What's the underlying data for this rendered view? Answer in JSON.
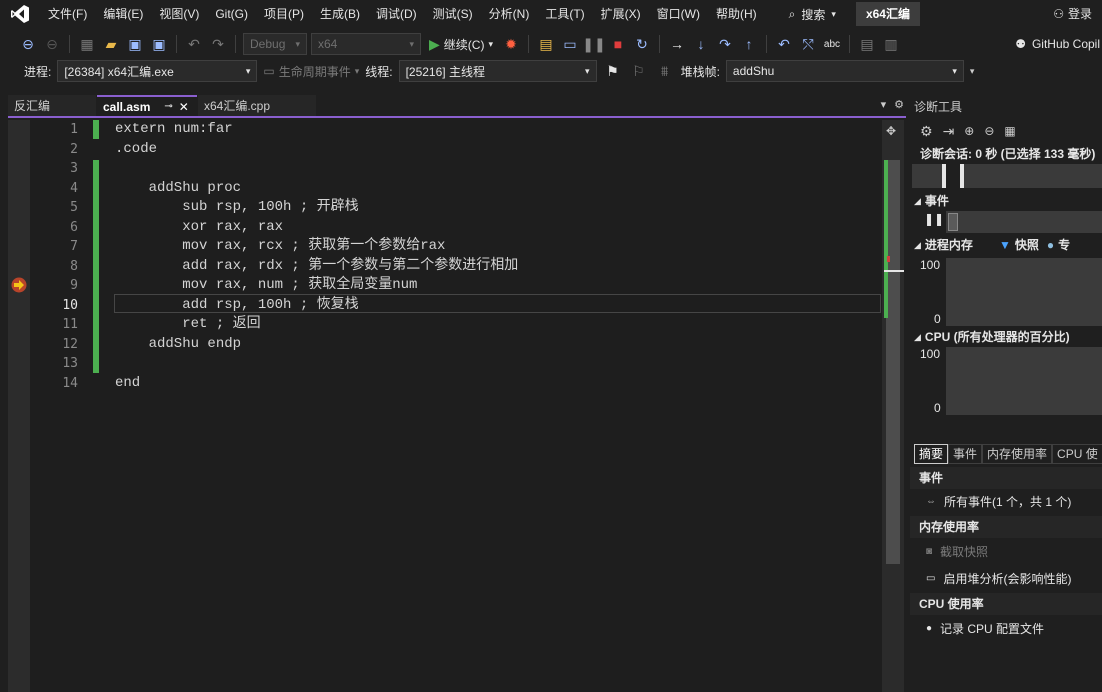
{
  "menubar": {
    "items": [
      "文件(F)",
      "编辑(E)",
      "视图(V)",
      "Git(G)",
      "项目(P)",
      "生成(B)",
      "调试(D)",
      "测试(S)",
      "分析(N)",
      "工具(T)",
      "扩展(X)",
      "窗口(W)",
      "帮助(H)"
    ],
    "search_label": "搜索",
    "solution_title": "x64汇编",
    "login_label": "登录"
  },
  "toolbar1": {
    "config": "Debug",
    "platform": "x64",
    "continue_label": "继续(C)",
    "copilot_label": "GitHub Copil"
  },
  "toolbar2": {
    "process_label": "进程:",
    "process_value": "[26384] x64汇编.exe",
    "lifecycle_label": "生命周期事件",
    "thread_label": "线程:",
    "thread_value": "[25216] 主线程",
    "stack_label": "堆栈帧:",
    "stack_value": "addShu"
  },
  "tabs": [
    {
      "label": "反汇编",
      "active": false
    },
    {
      "label": "call.asm",
      "active": true
    },
    {
      "label": "x64汇编.cpp",
      "active": false
    }
  ],
  "editor": {
    "current_line": 10,
    "breakpoint_line": 9,
    "lines": [
      {
        "num": "1",
        "text": "extern num:far"
      },
      {
        "num": "2",
        "text": ".code"
      },
      {
        "num": "3",
        "text": ""
      },
      {
        "num": "4",
        "text": "    addShu proc"
      },
      {
        "num": "5",
        "text": "        sub rsp, 100h ; 开辟栈"
      },
      {
        "num": "6",
        "text": "        xor rax, rax"
      },
      {
        "num": "7",
        "text": "        mov rax, rcx ; 获取第一个参数给rax"
      },
      {
        "num": "8",
        "text": "        add rax, rdx ; 第一个参数与第二个参数进行相加"
      },
      {
        "num": "9",
        "text": "        mov rax, num ; 获取全局变量num"
      },
      {
        "num": "10",
        "text": "        add rsp, 100h ; 恢复栈"
      },
      {
        "num": "11",
        "text": "        ret ; 返回"
      },
      {
        "num": "12",
        "text": "    addShu endp"
      },
      {
        "num": "13",
        "text": ""
      },
      {
        "num": "14",
        "text": "end"
      }
    ]
  },
  "diagnostics": {
    "title": "诊断工具",
    "session": "诊断会话: 0 秒 (已选择 133 毫秒)",
    "events_header": "事件",
    "memory_header": "进程内存",
    "snapshot_legend": "快照",
    "private_legend": "专",
    "cpu_header": "CPU (所有处理器的百分比)",
    "axis_max": "100",
    "axis_min": "0",
    "tabs": [
      "摘要",
      "事件",
      "内存使用率",
      "CPU 使"
    ],
    "sections": [
      {
        "title": "事件",
        "items": [
          {
            "label": "所有事件(1 个，共 1 个)",
            "enabled": true
          }
        ]
      },
      {
        "title": "内存使用率",
        "items": [
          {
            "label": "截取快照",
            "enabled": false
          },
          {
            "label": "启用堆分析(会影响性能)",
            "enabled": true
          }
        ]
      },
      {
        "title": "CPU 使用率",
        "items": [
          {
            "label": "记录 CPU 配置文件",
            "enabled": true
          }
        ]
      }
    ]
  },
  "colors": {
    "accent": "#8a5fcf",
    "change_bar": "#4caf50",
    "background": "#1f1f1f"
  }
}
